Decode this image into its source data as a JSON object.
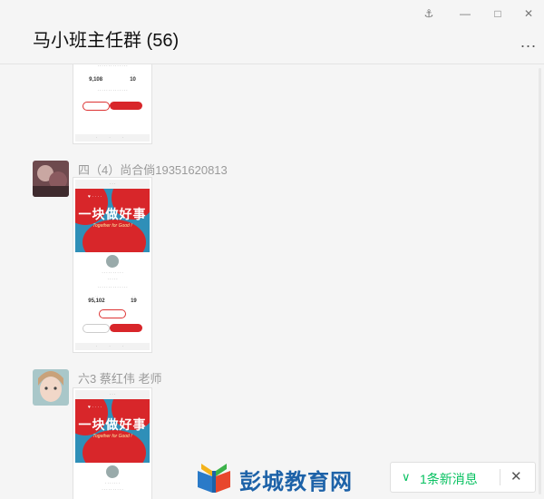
{
  "window": {
    "title": "马小班主任群 (56)",
    "controls": [
      "pin",
      "minimize",
      "maximize",
      "close"
    ],
    "more_label": "..."
  },
  "messages": [
    {
      "sender": "",
      "image": {
        "stats": [
          "9,108",
          "10"
        ],
        "buttons": [
          "",
          ""
        ]
      }
    },
    {
      "sender": "四（4）尚合倘19351620813",
      "image": {
        "poster_title": "一块做好事",
        "poster_sub": "Together for Good !",
        "stats": [
          "95,102",
          "19"
        ]
      }
    },
    {
      "sender": "六3 蔡红伟 老师",
      "image": {
        "poster_title": "一块做好事",
        "poster_sub": "Together for Good !"
      }
    }
  ],
  "watermark": {
    "text": "彭城教育网"
  },
  "toast": {
    "icon": "chevron-down-icon",
    "text": "1条新消息",
    "close": "✕"
  },
  "colors": {
    "accent": "#07c160",
    "brand_red": "#d8262a",
    "watermark_blue": "#1d62a8"
  }
}
